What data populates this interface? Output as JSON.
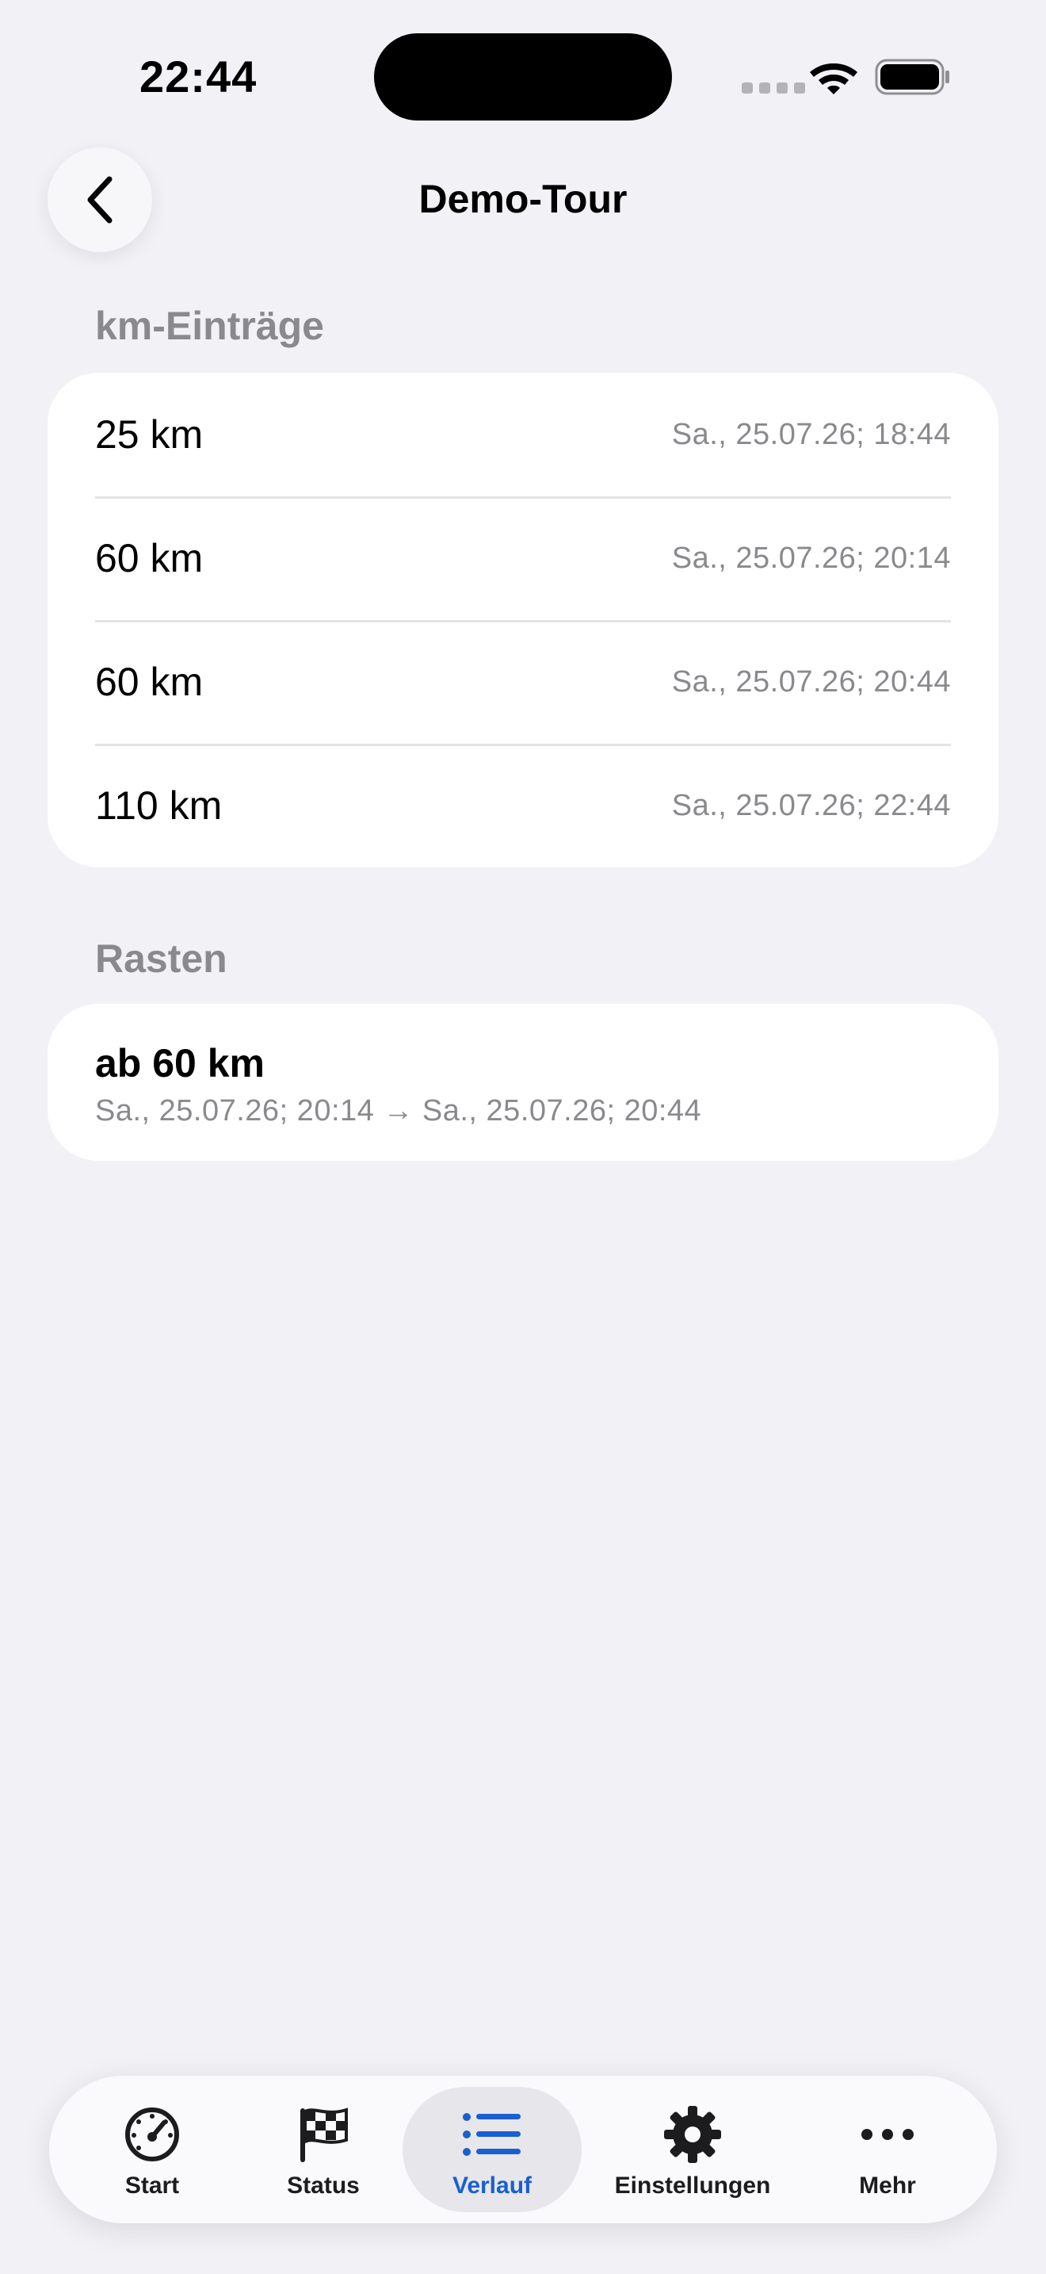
{
  "status_bar": {
    "time": "22:44"
  },
  "nav": {
    "title": "Demo-Tour",
    "back_icon": "chevron-left-icon"
  },
  "km_section": {
    "header": "km-Einträge",
    "rows": [
      {
        "distance": "25 km",
        "timestamp": "Sa., 25.07.26; 18:44"
      },
      {
        "distance": "60 km",
        "timestamp": "Sa., 25.07.26; 20:14"
      },
      {
        "distance": "60 km",
        "timestamp": "Sa., 25.07.26; 20:44"
      },
      {
        "distance": "110 km",
        "timestamp": "Sa., 25.07.26; 22:44"
      }
    ]
  },
  "pause_section": {
    "header": "Rasten",
    "items": [
      {
        "title": "ab 60 km",
        "range": "Sa., 25.07.26; 20:14 → Sa., 25.07.26; 20:44"
      }
    ]
  },
  "tab_bar": {
    "active_index": 2,
    "active_color": "#1A5FD0",
    "tabs": [
      {
        "label": "Start",
        "icon": "speedometer-icon"
      },
      {
        "label": "Status",
        "icon": "checkered-flag-icon"
      },
      {
        "label": "Verlauf",
        "icon": "list-icon"
      },
      {
        "label": "Einstellungen",
        "icon": "gear-icon"
      },
      {
        "label": "Mehr",
        "icon": "ellipsis-icon"
      }
    ]
  }
}
